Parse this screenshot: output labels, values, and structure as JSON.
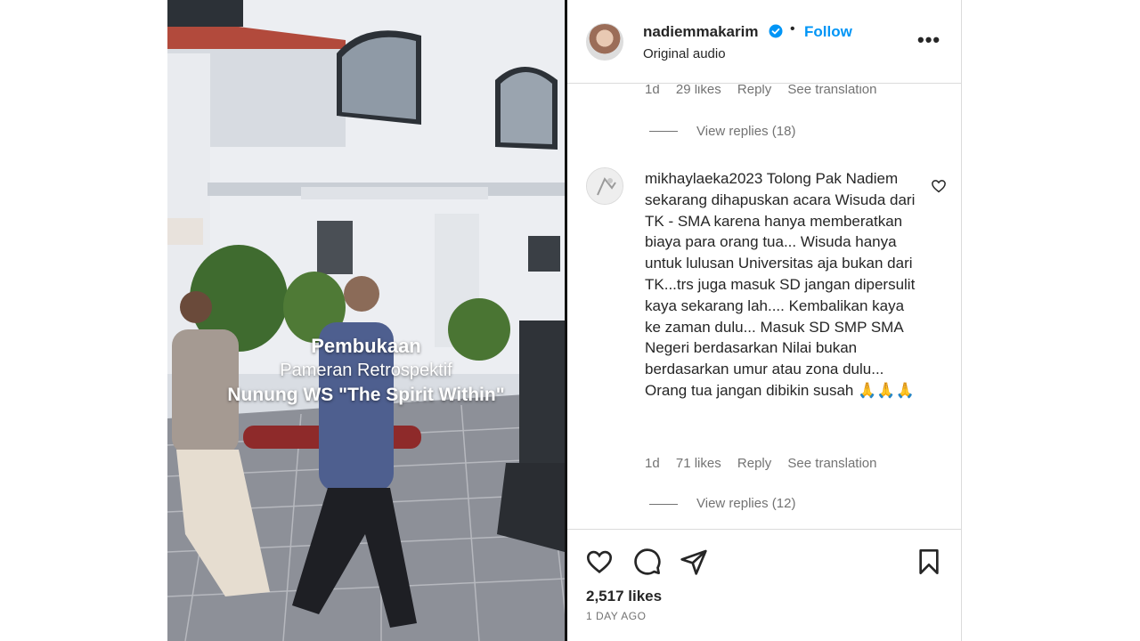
{
  "post": {
    "username": "nadiemmakarim",
    "dot": "•",
    "follow_label": "Follow",
    "audio": "Original audio",
    "more_label": "•••"
  },
  "video_overlay": {
    "line1": "Pembukaan",
    "line2": "Pameran Retrospektif",
    "line3": "Nunung WS \"The Spirit Within\""
  },
  "comments": [
    {
      "time": "1d",
      "likes": "29 likes",
      "reply_label": "Reply",
      "translation_label": "See translation",
      "view_replies": "View replies (18)"
    },
    {
      "username": "mikhaylaeka2023",
      "text": "Tolong Pak Nadiem sekarang dihapuskan acara Wisuda dari TK - SMA karena hanya memberatkan biaya para orang tua... Wisuda hanya untuk lulusan Universitas aja bukan dari TK...trs juga masuk SD jangan dipersulit kaya sekarang lah.... Kembalikan kaya ke zaman dulu... Masuk SD SMP SMA Negeri berdasarkan Nilai bukan berdasarkan umur atau zona dulu... Orang tua jangan dibikin susah 🙏🙏🙏",
      "time": "1d",
      "likes": "71 likes",
      "reply_label": "Reply",
      "translation_label": "See translation",
      "view_replies": "View replies (12)"
    }
  ],
  "footer": {
    "likes": "2,517 likes",
    "date": "1 DAY AGO"
  },
  "icons": {
    "verified": "verified-badge-icon",
    "like": "heart-icon",
    "comment": "comment-bubble-icon",
    "share": "paper-plane-icon",
    "save": "bookmark-icon"
  },
  "colors": {
    "accent": "#0095f6",
    "muted": "#737373",
    "text": "#262626",
    "border": "#dbdbdb"
  }
}
